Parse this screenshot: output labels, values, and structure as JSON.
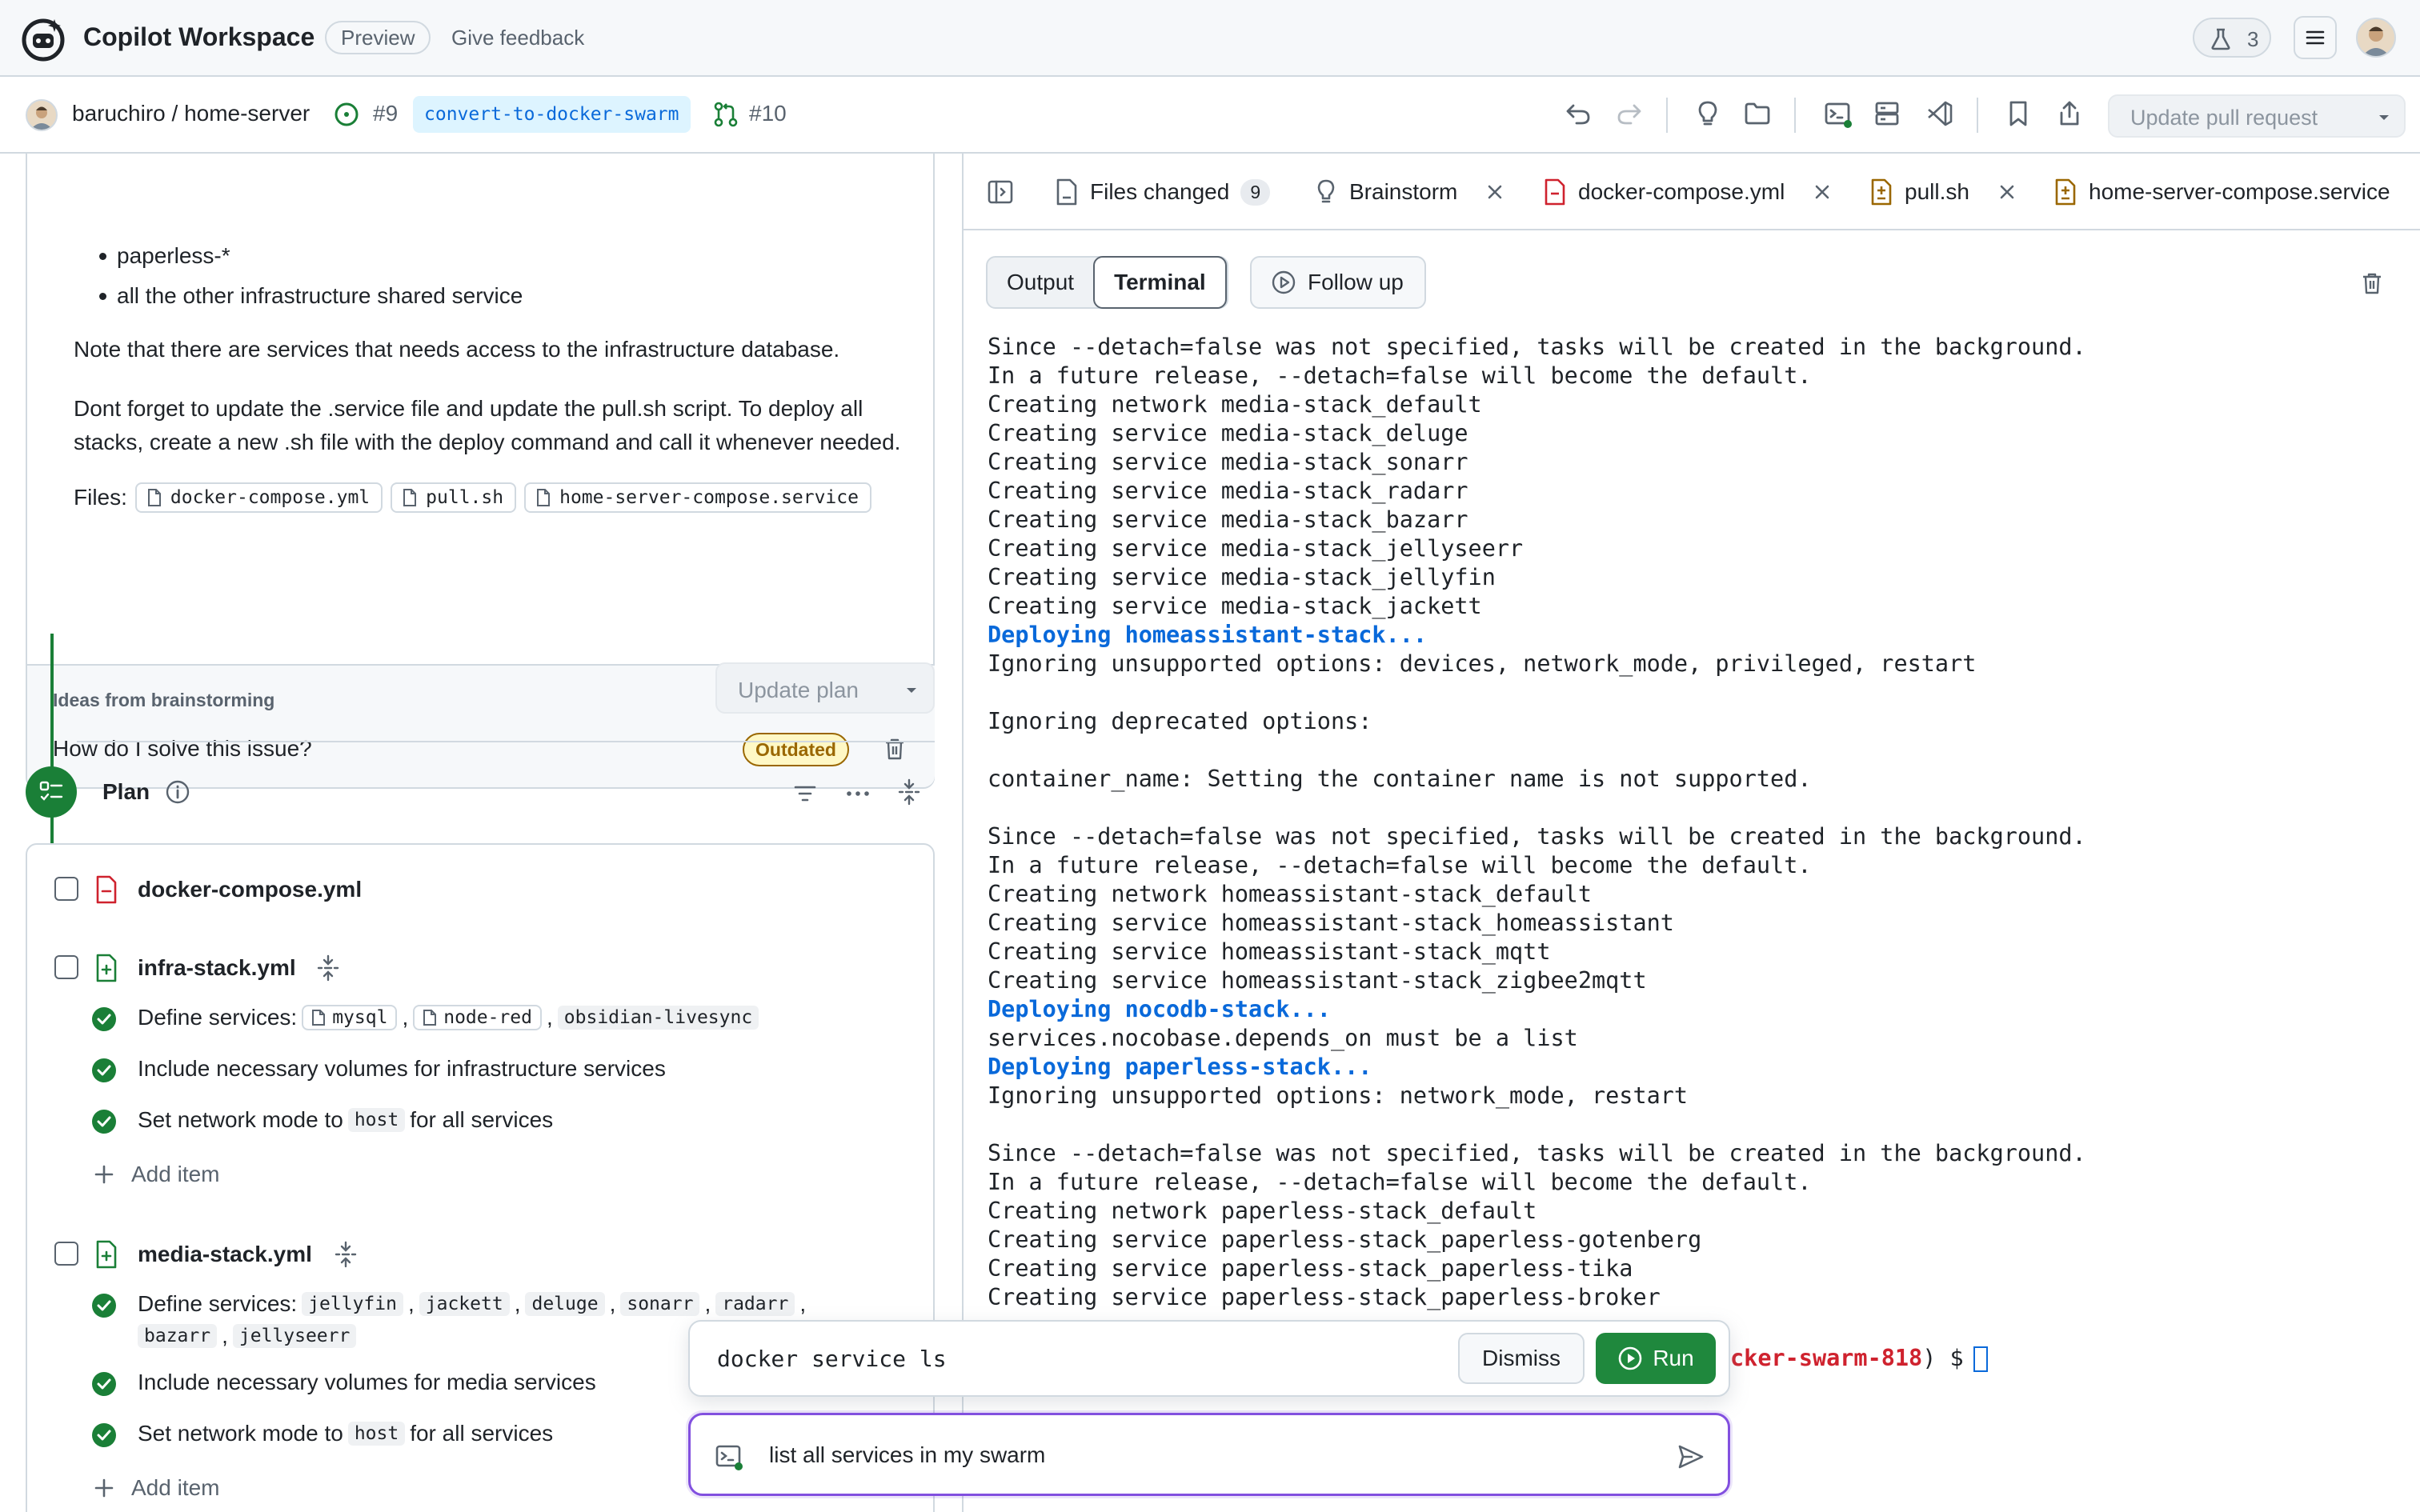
{
  "app": {
    "title": "Copilot Workspace",
    "badge": "Preview",
    "feedback": "Give feedback",
    "experiments_count": "3"
  },
  "repo": {
    "path": "baruchiro / home-server",
    "issue": "#9",
    "branch": "convert-to-docker-swarm",
    "pr": "#10"
  },
  "toolbar": {
    "update_pr_label": "Update pull request"
  },
  "task": {
    "bullets": [
      "paperless-*",
      "all the other infrastructure shared service"
    ],
    "paragraph_1": "Note that there are services that needs access to the infrastructure database.",
    "paragraph_2_line1": "Dont forget to update the .service file and update the pull.sh script. To deploy all",
    "paragraph_2_line2": "stacks, create a new .sh file with the deploy command and call it whenever needed.",
    "files_label": "Files:",
    "files": [
      "docker-compose.yml",
      "pull.sh",
      "home-server-compose.service"
    ],
    "ideas_heading": "Ideas from brainstorming",
    "ideas_question": "How do I solve this issue?",
    "ideas_badge": "Outdated",
    "update_plan_label": "Update plan"
  },
  "plan": {
    "title": "Plan",
    "files": [
      {
        "name": "docker-compose.yml"
      },
      {
        "name": "infra-stack.yml",
        "define_label": "Define services:",
        "services": [
          "mysql",
          "node-red",
          "obsidian-livesync"
        ],
        "step2": "Include necessary volumes for infrastructure services",
        "step3_pre": "Set network mode to",
        "step3_code": "host",
        "step3_post": "for all services",
        "add_item": "Add item"
      },
      {
        "name": "media-stack.yml",
        "define_label": "Define services:",
        "services": [
          "jellyfin",
          "jackett",
          "deluge",
          "sonarr",
          "radarr",
          "bazarr",
          "jellyseerr"
        ],
        "step2": "Include necessary volumes for media services",
        "step3_pre": "Set network mode to",
        "step3_code": "host",
        "step3_post": "for all services",
        "add_item": "Add item"
      }
    ]
  },
  "tabs": {
    "files_changed": "Files changed",
    "files_changed_count": "9",
    "brainstorm": "Brainstorm",
    "docker_compose": "docker-compose.yml",
    "pull_sh": "pull.sh",
    "service": "home-server-compose.service"
  },
  "terminal_controls": {
    "output": "Output",
    "terminal": "Terminal",
    "follow_up": "Follow up"
  },
  "terminal": {
    "lines": [
      {
        "text": "Since --detach=false was not specified, tasks will be created in the background.",
        "kind": "normal"
      },
      {
        "text": "In a future release, --detach=false will become the default.",
        "kind": "normal"
      },
      {
        "text": "Creating network media-stack_default",
        "kind": "normal"
      },
      {
        "text": "Creating service media-stack_deluge",
        "kind": "normal"
      },
      {
        "text": "Creating service media-stack_sonarr",
        "kind": "normal"
      },
      {
        "text": "Creating service media-stack_radarr",
        "kind": "normal"
      },
      {
        "text": "Creating service media-stack_bazarr",
        "kind": "normal"
      },
      {
        "text": "Creating service media-stack_jellyseerr",
        "kind": "normal"
      },
      {
        "text": "Creating service media-stack_jellyfin",
        "kind": "normal"
      },
      {
        "text": "Creating service media-stack_jackett",
        "kind": "normal"
      },
      {
        "text": "Deploying homeassistant-stack...",
        "kind": "info"
      },
      {
        "text": "Ignoring unsupported options: devices, network_mode, privileged, restart",
        "kind": "normal"
      },
      {
        "text": "",
        "kind": "normal"
      },
      {
        "text": "Ignoring deprecated options:",
        "kind": "normal"
      },
      {
        "text": "",
        "kind": "normal"
      },
      {
        "text": "container_name: Setting the container name is not supported.",
        "kind": "normal"
      },
      {
        "text": "",
        "kind": "normal"
      },
      {
        "text": "Since --detach=false was not specified, tasks will be created in the background.",
        "kind": "normal"
      },
      {
        "text": "In a future release, --detach=false will become the default.",
        "kind": "normal"
      },
      {
        "text": "Creating network homeassistant-stack_default",
        "kind": "normal"
      },
      {
        "text": "Creating service homeassistant-stack_homeassistant",
        "kind": "normal"
      },
      {
        "text": "Creating service homeassistant-stack_mqtt",
        "kind": "normal"
      },
      {
        "text": "Creating service homeassistant-stack_zigbee2mqtt",
        "kind": "normal"
      },
      {
        "text": "Deploying nocodb-stack...",
        "kind": "info"
      },
      {
        "text": "services.nocobase.depends_on must be a list",
        "kind": "normal"
      },
      {
        "text": "Deploying paperless-stack...",
        "kind": "info"
      },
      {
        "text": "Ignoring unsupported options: network_mode, restart",
        "kind": "normal"
      },
      {
        "text": "",
        "kind": "normal"
      },
      {
        "text": "Since --detach=false was not specified, tasks will be created in the background.",
        "kind": "normal"
      },
      {
        "text": "In a future release, --detach=false will become the default.",
        "kind": "normal"
      },
      {
        "text": "Creating network paperless-stack_default",
        "kind": "normal"
      },
      {
        "text": "Creating service paperless-stack_paperless-gotenberg",
        "kind": "normal"
      },
      {
        "text": "Creating service paperless-stack_paperless-tika",
        "kind": "normal"
      },
      {
        "text": "Creating service paperless-stack_paperless-broker",
        "kind": "normal"
      }
    ],
    "prompt_branch_tail": "cker-swarm-818",
    "prompt_suffix": ") $"
  },
  "command_suggestion": {
    "command": "docker service ls",
    "dismiss": "Dismiss",
    "run": "Run"
  },
  "ask": {
    "text": "list all services in my swarm"
  },
  "colors": {
    "accent": "#0969da",
    "success": "#1a7f37",
    "run_button": "#1f883d",
    "input_focus": "#8250df",
    "danger": "#cf222e",
    "warning": "#9a6700"
  }
}
